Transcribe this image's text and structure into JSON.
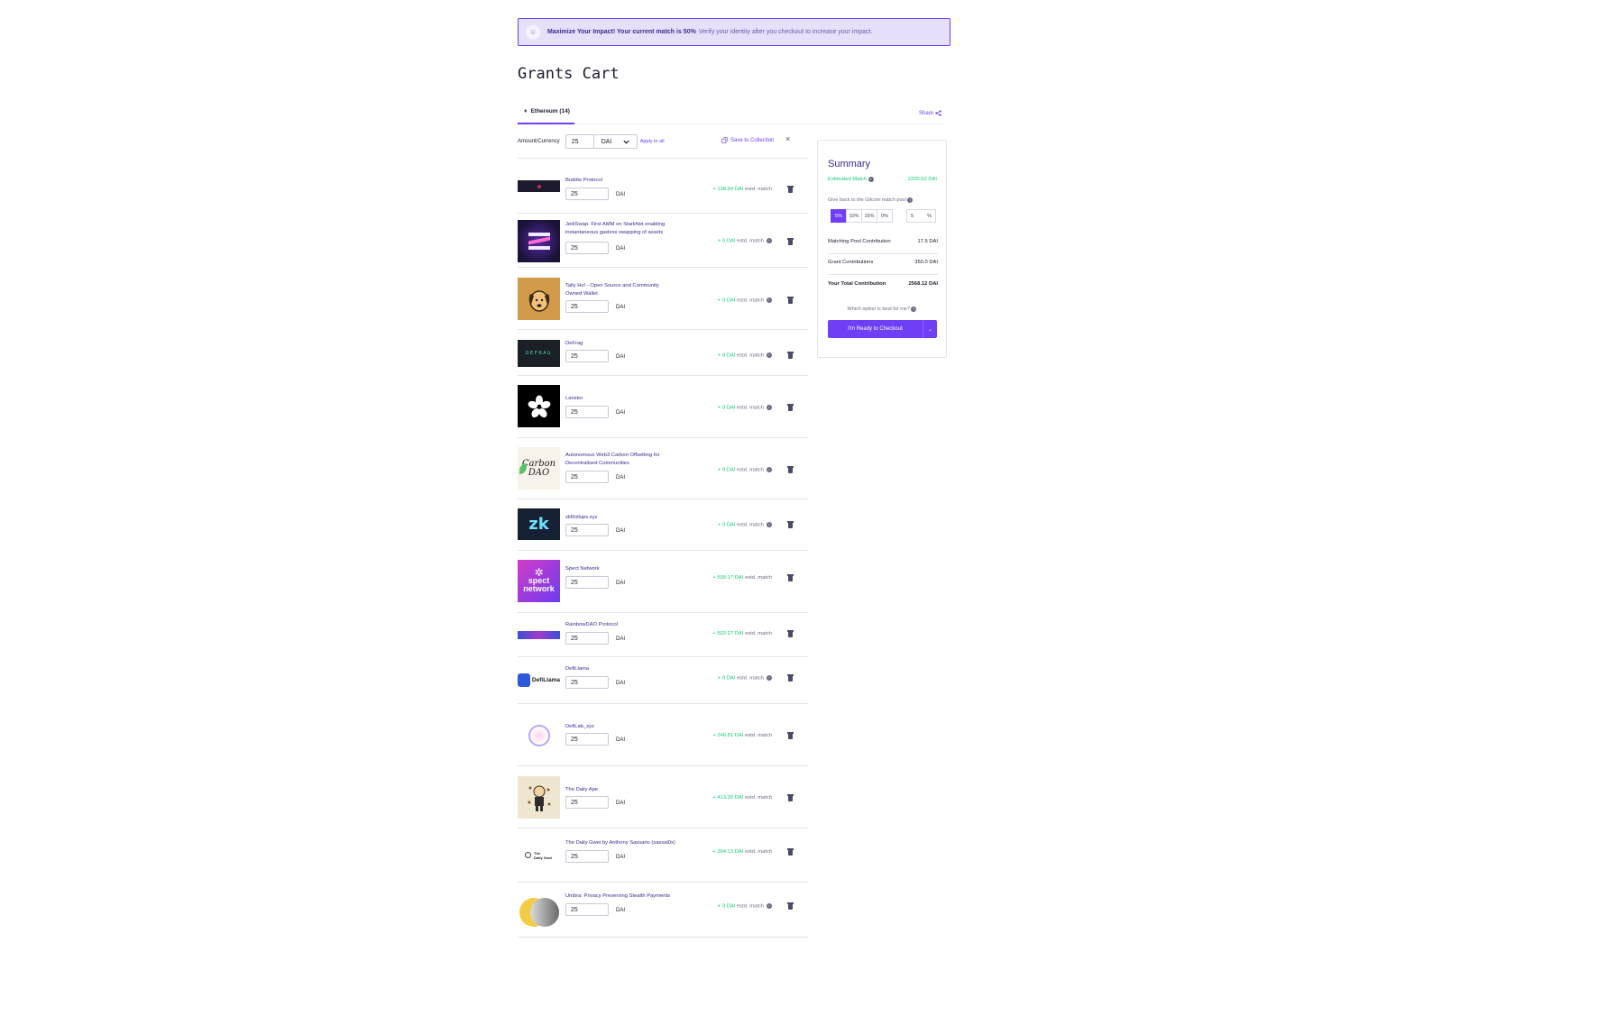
{
  "banner": {
    "icon": "emoji-icon",
    "strong": "Maximize Your Impact! Your current match is 50%",
    "text": "Verify your identity after you checkout to increase your impact."
  },
  "page": {
    "title": "Grants Cart"
  },
  "tabs": {
    "ethereum": "Ethereum (14)",
    "share": "Share"
  },
  "controls": {
    "amount_label": "Amount/Currency",
    "amount": "25",
    "currency": "DAI",
    "apply_all": "Apply to all",
    "save_collection": "Save to Collection"
  },
  "match_suffix": "estd. match",
  "grants": [
    {
      "name": "Buddie Protocol",
      "amount": "25",
      "currency": "DAI",
      "match": "+ 138.94 DAI",
      "has_info": false
    },
    {
      "name": "JediSwap: First AMM on StarkNet enabling instantaneous gasless swapping of assets",
      "amount": "25",
      "currency": "DAI",
      "match": "+ 0 DAI",
      "has_info": true
    },
    {
      "name": "Tally Ho! - Open Source and Community Owned Wallet",
      "amount": "25",
      "currency": "DAI",
      "match": "+ 0 DAI",
      "has_info": true
    },
    {
      "name": "DeFrag",
      "amount": "25",
      "currency": "DAI",
      "match": "+ 0 DAI",
      "has_info": true
    },
    {
      "name": "Lanstor",
      "amount": "25",
      "currency": "DAI",
      "match": "+ 0 DAI",
      "has_info": true
    },
    {
      "name": "Autonomous Web3 Carbon Offsetting for Decentralised Communities",
      "amount": "25",
      "currency": "DAI",
      "match": "+ 0 DAI",
      "has_info": true
    },
    {
      "name": "zkRollups.xyz",
      "amount": "25",
      "currency": "DAI",
      "match": "+ 0 DAI",
      "has_info": true
    },
    {
      "name": "Spect Network",
      "amount": "25",
      "currency": "DAI",
      "match": "+ 505.17 DAI",
      "has_info": false
    },
    {
      "name": "RainbowDAO Protocol",
      "amount": "25",
      "currency": "DAI",
      "match": "+ 502.27 DAI",
      "has_info": false
    },
    {
      "name": "DefiLlama",
      "amount": "25",
      "currency": "DAI",
      "match": "+ 0 DAI",
      "has_info": true
    },
    {
      "name": "DefiLab_xyz",
      "amount": "25",
      "currency": "DAI",
      "match": "+ 246.81 DAI",
      "has_info": false
    },
    {
      "name": "The Daily Ape",
      "amount": "25",
      "currency": "DAI",
      "match": "+ 413.30 DAI",
      "has_info": false
    },
    {
      "name": "The Daily Gwei by Anthony Sassano (sassal0x)",
      "amount": "25",
      "currency": "DAI",
      "match": "+ 394.13 DAI",
      "has_info": false
    },
    {
      "name": "Umbra: Privacy Preserving Stealth Payments",
      "amount": "25",
      "currency": "DAI",
      "match": "+ 0 DAI",
      "has_info": true
    }
  ],
  "logos": {
    "defrag": "DEFRAG",
    "carbon_line1": "Carbon",
    "carbon_line2": "DAO",
    "zk": "zk",
    "spect_line1": "spect",
    "spect_line2": "network",
    "defillama": "DefiLlama",
    "dailygwei_line1": "The",
    "dailygwei_line2": "Daily Gwei"
  },
  "summary": {
    "title": "Summary",
    "estimated_match_label": "Estimated Match",
    "estimated_match_value": "2200.62 DAI",
    "give_back_label": "Give back to the Gitcoin match pool",
    "percent_options": [
      "5%",
      "10%",
      "15%",
      "0%"
    ],
    "selected_percent": "5%",
    "custom_value": "5",
    "custom_suffix": "%",
    "matching_pool_label": "Matching Pool Contribution",
    "matching_pool_value": "17.5 DAI",
    "grant_contrib_label": "Grant Contributions",
    "grant_contrib_value": "350.0 DAI",
    "total_label": "Your Total Contribution",
    "total_value": "2568.12 DAI",
    "which_option": "Which option is best for me?",
    "checkout_label": "I'm Ready to Checkout"
  },
  "colors": {
    "accent": "#6f3ff5",
    "match_green": "#0fce7c",
    "banner_bg": "#e6e0fb"
  }
}
